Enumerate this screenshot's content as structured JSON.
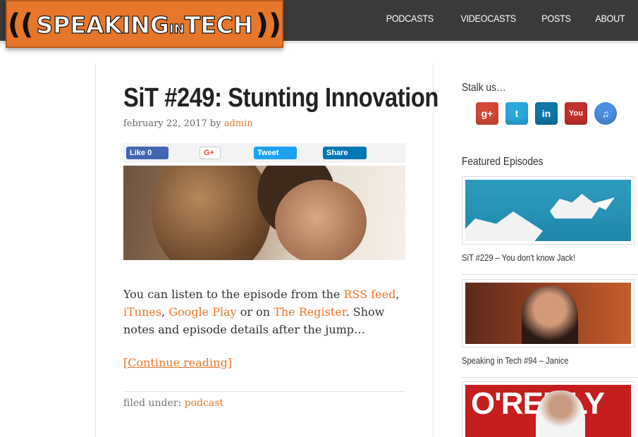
{
  "header": {
    "logo": "SPEAKINGINTECH",
    "logo_parts": [
      "SPEAKING",
      "IN",
      "TECH"
    ],
    "nav": [
      "PODCASTS",
      "VIDEOCASTS",
      "POSTS",
      "ABOUT"
    ]
  },
  "post": {
    "title": "SiT #249: Stunting Innovation",
    "date": "february 22, 2017",
    "by": "by",
    "author": "admin",
    "share": {
      "facebook": "Like 0",
      "google": "G+",
      "twitter": "Tweet",
      "linkedin": "Share"
    },
    "body_prefix": "You can listen to the episode from the ",
    "link_rss": "RSS feed",
    "comma1": ",",
    "link_itunes": "iTunes",
    "comma2": ",",
    "link_google": "Google Play",
    "or_on": " or on ",
    "link_register": "The Register",
    "body_suffix": ". Show notes and episode details after the jump…",
    "continue": "[Continue reading]",
    "filed_under_label": "filed under:",
    "category": "podcast"
  },
  "sidebar": {
    "stalk_title": "Stalk us…",
    "social": [
      {
        "name": "google-plus",
        "label": "g+",
        "color": "#d34836"
      },
      {
        "name": "twitter",
        "label": "t",
        "color": "#2aa9e0"
      },
      {
        "name": "linkedin",
        "label": "in",
        "color": "#0e76a8"
      },
      {
        "name": "youtube",
        "label": "You",
        "color": "#c4302b"
      },
      {
        "name": "itunes",
        "label": "♫",
        "color": "#4a8fe3"
      }
    ],
    "featured_title": "Featured Episodes",
    "featured": [
      {
        "title": "SiT #229 – You don't know Jack!"
      },
      {
        "title": "Speaking in Tech #94 – Janice"
      },
      {
        "title": ""
      }
    ],
    "oreilly_text": "O'REILLY"
  }
}
